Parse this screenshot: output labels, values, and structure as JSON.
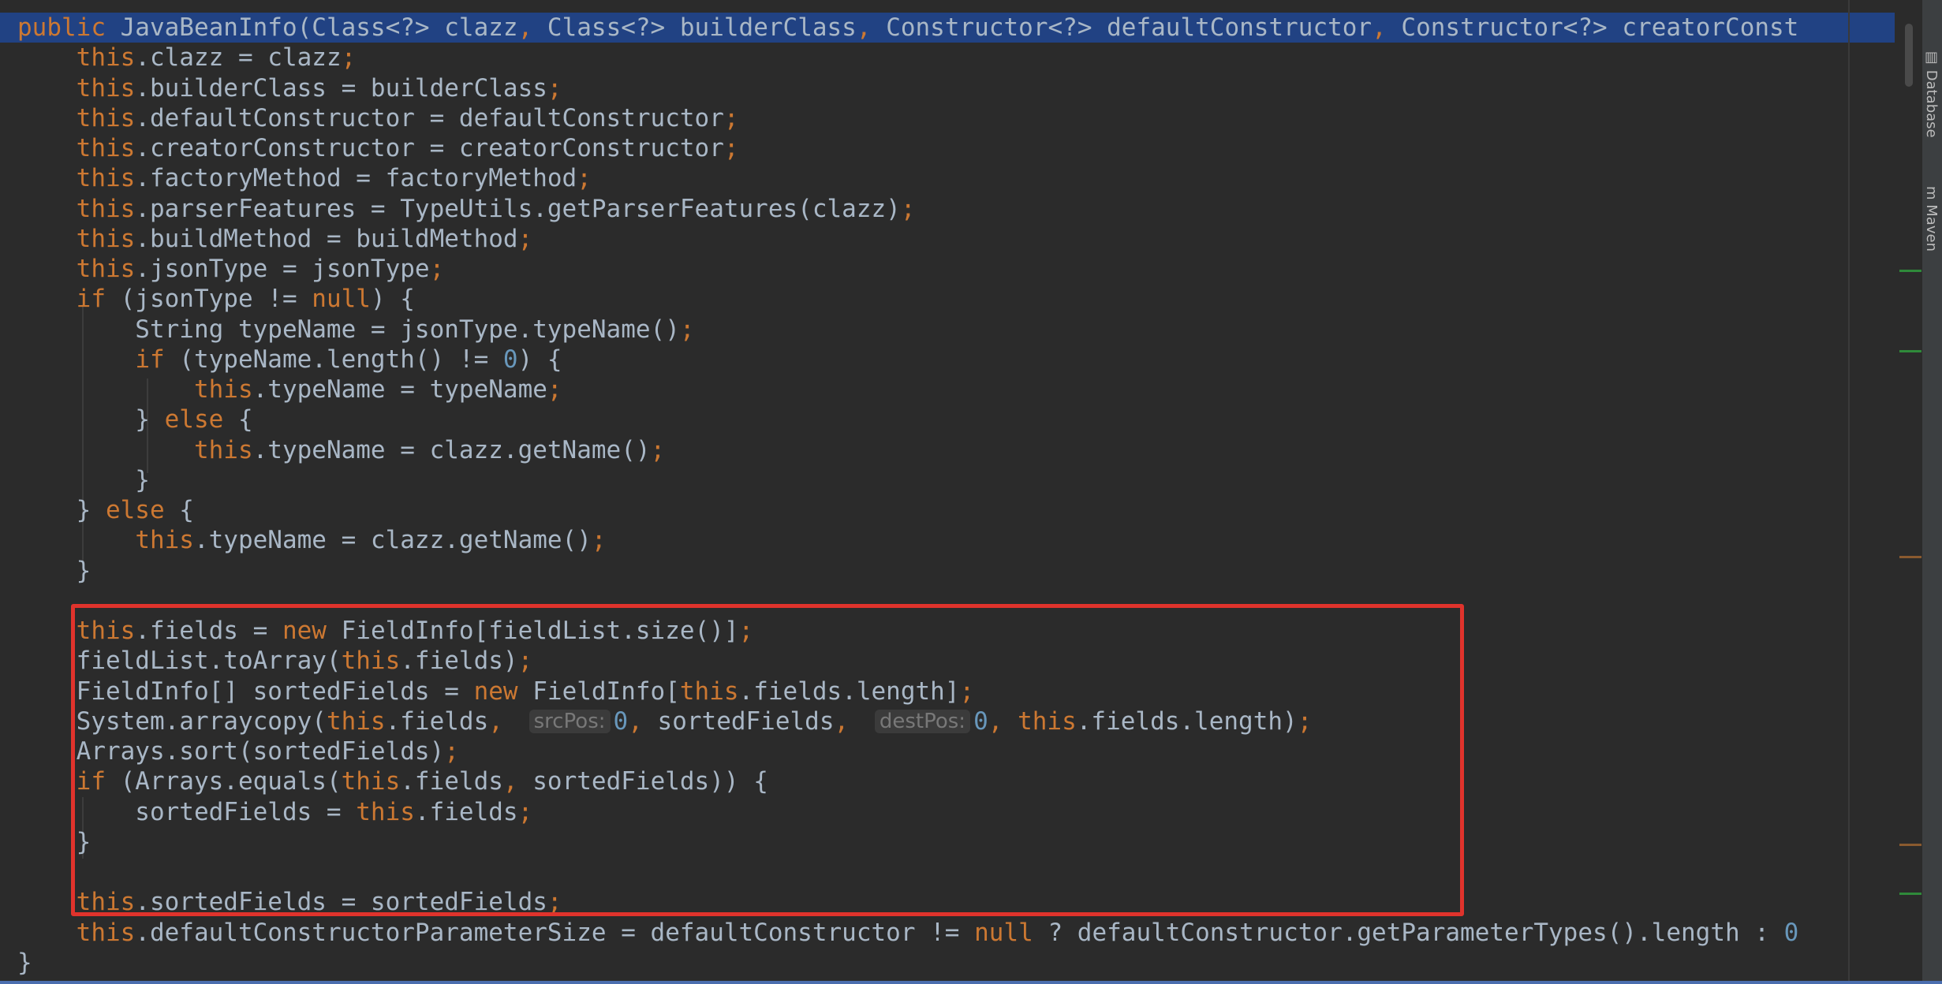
{
  "editor": {
    "lines": [
      "public JavaBeanInfo(Class<?> clazz, Class<?> builderClass, Constructor<?> defaultConstructor, Constructor<?> creatorConst",
      "    this.clazz = clazz;",
      "    this.builderClass = builderClass;",
      "    this.defaultConstructor = defaultConstructor;",
      "    this.creatorConstructor = creatorConstructor;",
      "    this.factoryMethod = factoryMethod;",
      "    this.parserFeatures = TypeUtils.getParserFeatures(clazz);",
      "    this.buildMethod = buildMethod;",
      "    this.jsonType = jsonType;",
      "    if (jsonType != null) {",
      "        String typeName = jsonType.typeName();",
      "        if (typeName.length() != 0) {",
      "            this.typeName = typeName;",
      "        } else {",
      "            this.typeName = clazz.getName();",
      "        }",
      "    } else {",
      "        this.typeName = clazz.getName();",
      "    }",
      "",
      "    this.fields = new FieldInfo[fieldList.size()];",
      "    fieldList.toArray(this.fields);",
      "    FieldInfo[] sortedFields = new FieldInfo[this.fields.length];",
      "    System.arraycopy(this.fields, srcPos: 0, sortedFields, destPos: 0, this.fields.length);",
      "    Arrays.sort(sortedFields);",
      "    if (Arrays.equals(this.fields, sortedFields)) {",
      "        sortedFields = this.fields;",
      "    }",
      "",
      "    this.sortedFields = sortedFields;",
      "    this.defaultConstructorParameterSize = defaultConstructor != null ? defaultConstructor.getParameterTypes().length : 0",
      "}"
    ],
    "param_hints": [
      "srcPos:",
      "destPos:"
    ]
  },
  "side_panel": {
    "tabs": [
      "Database",
      "Maven"
    ]
  },
  "colors": {
    "background": "#2b2b2b",
    "keyword": "#cc7832",
    "identifier": "#a9b7c6",
    "number": "#6897bb",
    "selection": "#214283",
    "highlight_box": "#e0332c"
  }
}
